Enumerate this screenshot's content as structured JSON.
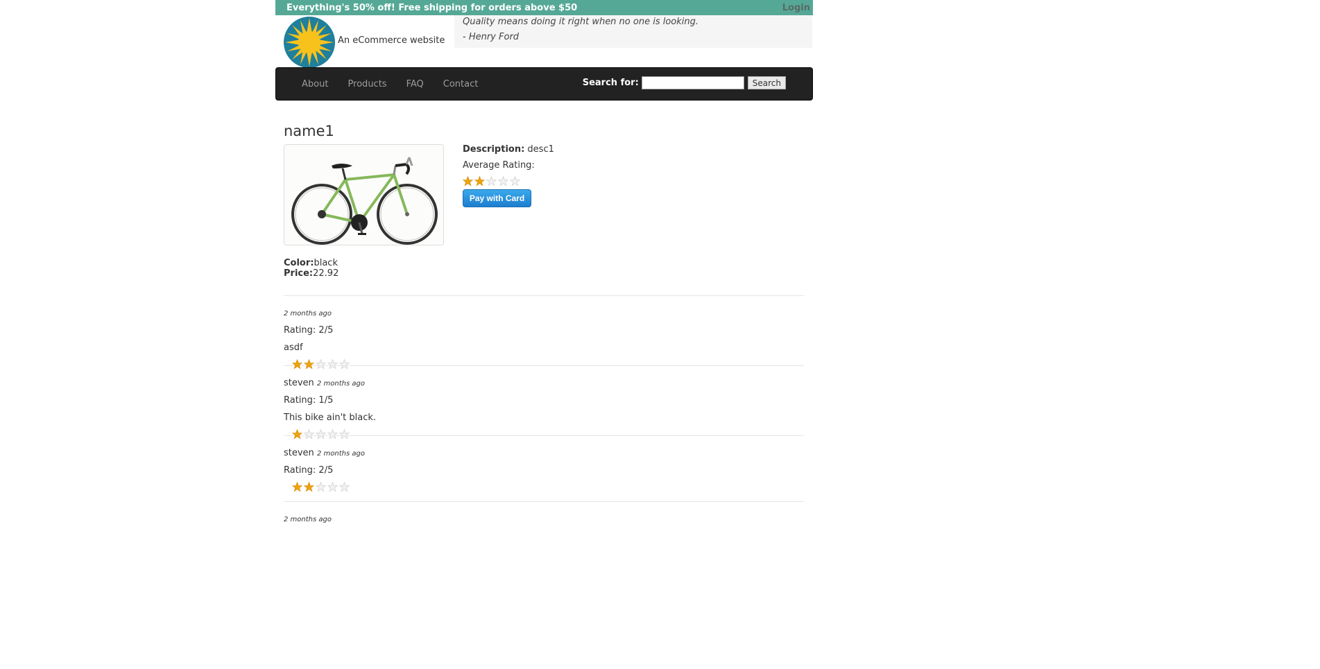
{
  "banner": {
    "promo": "Everything's 50% off! Free shipping for orders above $50",
    "login": "Login"
  },
  "header": {
    "tagline": "An eCommerce website",
    "quote": "Quality means doing it right when no one is looking.",
    "author": "- Henry Ford"
  },
  "nav": {
    "links": [
      "About",
      "Products",
      "FAQ",
      "Contact"
    ],
    "search_label": "Search for:",
    "search_value": "",
    "search_button": "Search"
  },
  "product": {
    "name": "name1",
    "description_label": "Description:",
    "description": "desc1",
    "avg_rating_label": "Average Rating:",
    "avg_rating": 2,
    "pay_button": "Pay with Card",
    "color_label": "Color:",
    "color": "black",
    "price_label": "Price:",
    "price": "22.92"
  },
  "reviews": [
    {
      "user": "",
      "time": "2 months ago",
      "rating_text": "Rating: 2/5",
      "comment": "asdf",
      "stars": 2
    },
    {
      "user": "steven",
      "time": "2 months ago",
      "rating_text": "Rating: 1/5",
      "comment": "This bike ain't black.",
      "stars": 1
    },
    {
      "user": "steven",
      "time": "2 months ago",
      "rating_text": "Rating: 2/5",
      "comment": "",
      "stars": 2
    },
    {
      "user": "",
      "time": "2 months ago",
      "rating_text": "",
      "comment": "",
      "stars": 0
    }
  ],
  "colors": {
    "banner": "#55a896",
    "navbar": "#222222",
    "star_filled": "#f0a30a",
    "star_empty": "#dddddd",
    "pay_button": "#1d7dcf"
  }
}
